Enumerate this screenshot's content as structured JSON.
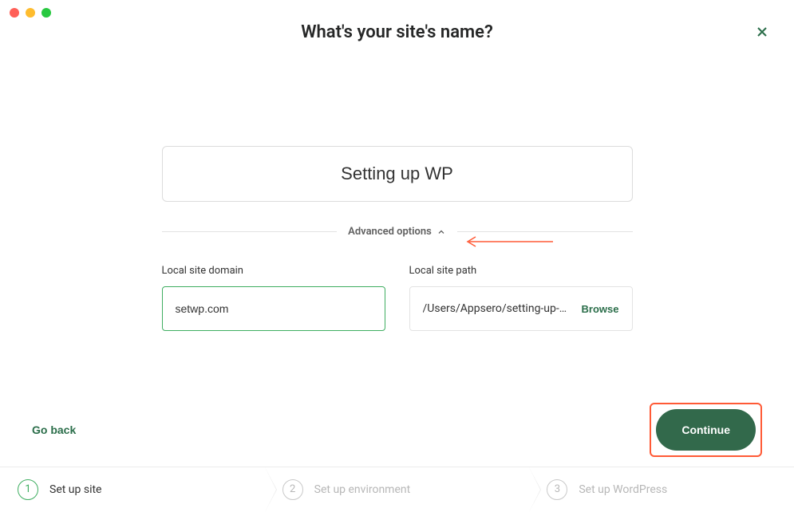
{
  "header": {
    "title": "What's your site's name?"
  },
  "siteName": {
    "value": "Setting up WP"
  },
  "advanced": {
    "label": "Advanced options"
  },
  "domain": {
    "label": "Local site domain",
    "value": "setwp.com"
  },
  "path": {
    "label": "Local site path",
    "value": "/Users/Appsero/setting-up-…",
    "browse": "Browse"
  },
  "actions": {
    "goBack": "Go back",
    "continue": "Continue"
  },
  "steps": [
    {
      "num": "1",
      "label": "Set up site"
    },
    {
      "num": "2",
      "label": "Set up environment"
    },
    {
      "num": "3",
      "label": "Set up WordPress"
    }
  ]
}
